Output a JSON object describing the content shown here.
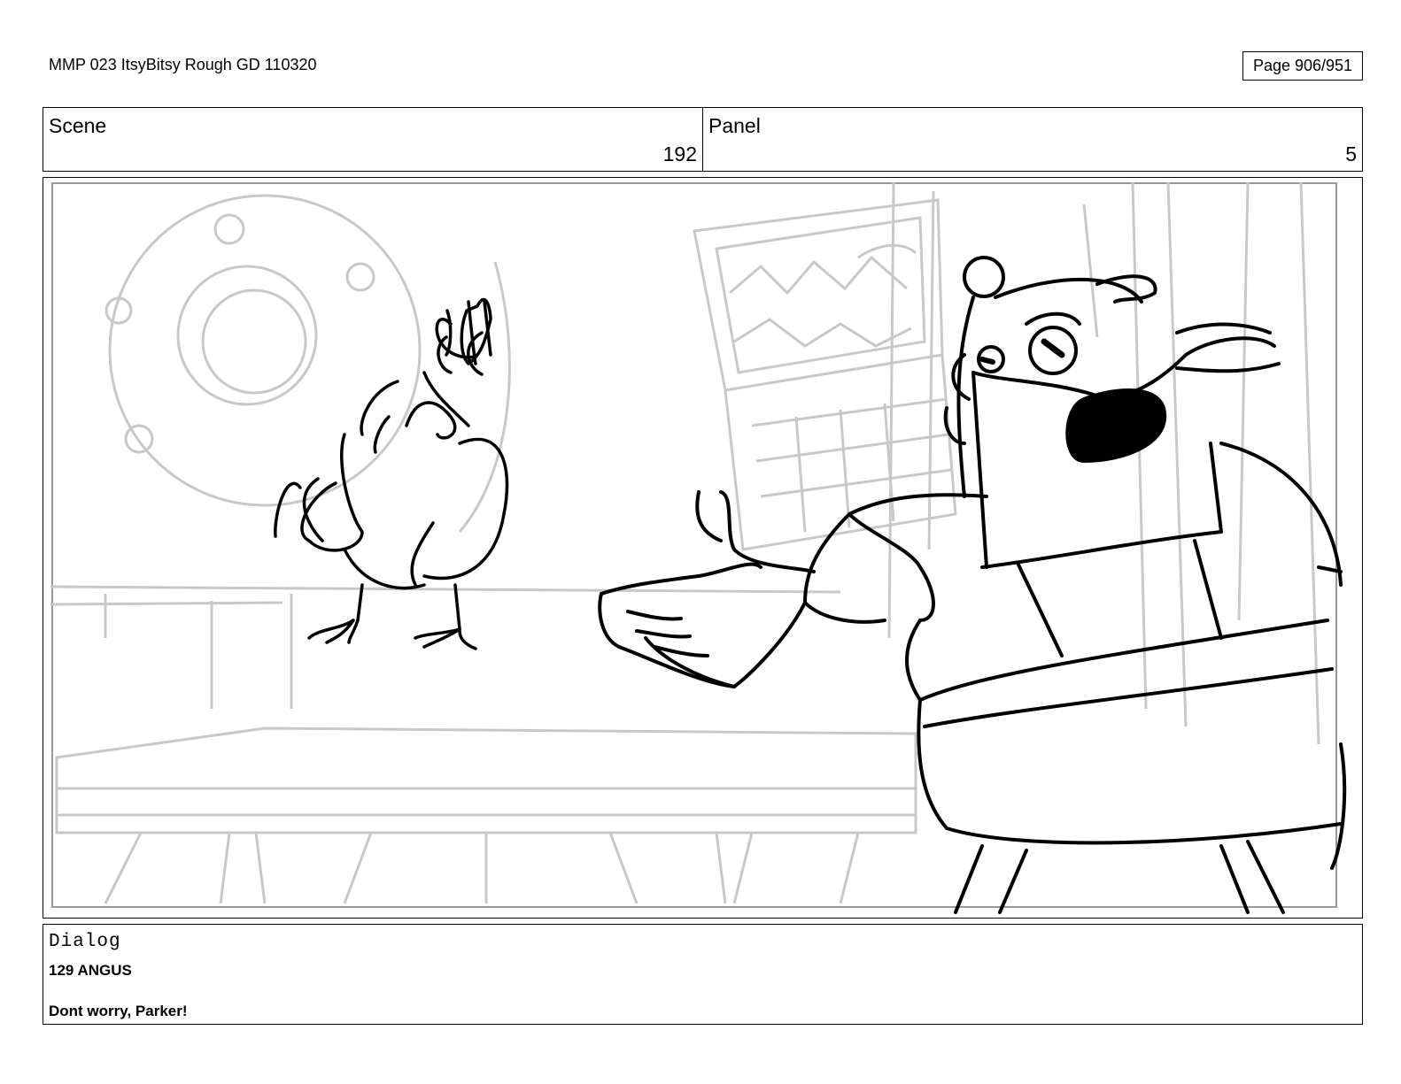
{
  "header": {
    "document_title": "MMP 023 ItsyBitsy Rough GD 110320",
    "page_indicator": "Page 906/951"
  },
  "info": {
    "scene_label": "Scene",
    "scene_number": "192",
    "panel_label": "Panel",
    "panel_number": "5"
  },
  "dialog": {
    "label": "Dialog",
    "speaker": "129 ANGUS",
    "line": "Dont worry, Parker!"
  }
}
